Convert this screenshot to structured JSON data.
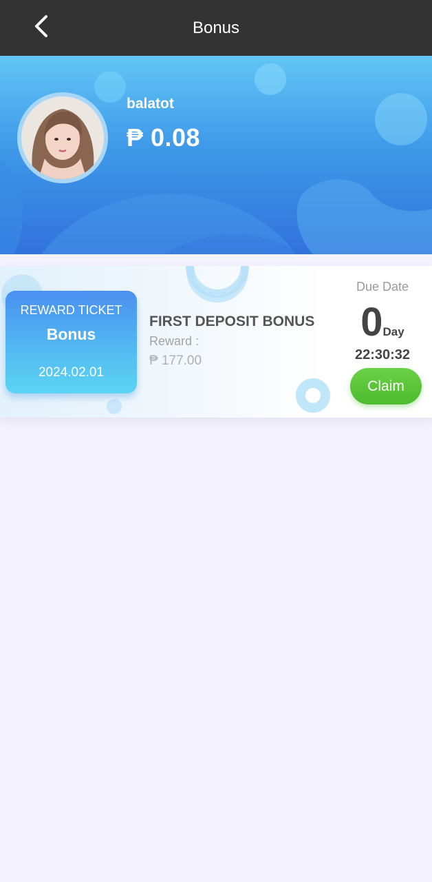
{
  "header": {
    "title": "Bonus",
    "back_icon": "chevron-left-icon"
  },
  "profile": {
    "username": "balatot",
    "balance": "₱ 0.08",
    "avatar_icon": "user-avatar"
  },
  "ticket": {
    "badge_title": "REWARD TICKET",
    "badge_name": "Bonus",
    "badge_date": "2024.02.01",
    "title": "FIRST DEPOSIT BONUS",
    "reward_label": "Reward :",
    "reward_amount": "₱ 177.00",
    "due_label": "Due Date",
    "due_days": "0",
    "due_unit": "Day",
    "countdown": "22:30:32",
    "claim_label": "Claim"
  },
  "colors": {
    "header_bg": "#333333",
    "banner_top": "#62c6f6",
    "banner_bottom": "#3172dd",
    "claim_green": "#4dbb2e",
    "page_bg": "#f4f3fd"
  }
}
